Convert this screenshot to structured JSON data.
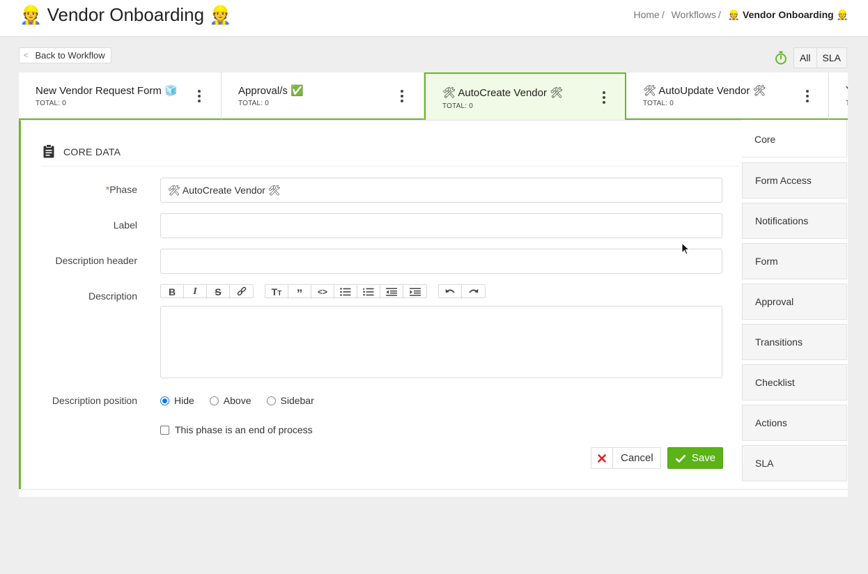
{
  "header": {
    "title": "👷 Vendor Onboarding 👷",
    "breadcrumb": [
      {
        "label": "Home"
      },
      {
        "label": "Workflows"
      }
    ],
    "breadcrumb_sep": "/",
    "breadcrumb_current": "👷 Vendor Onboarding 👷"
  },
  "toolbar": {
    "back_label": "Back to Workflow",
    "back_icon": "chevron-left-icon",
    "timer_icon": "stopwatch-icon",
    "segments": [
      "All",
      "SLA"
    ]
  },
  "phases": [
    {
      "title": "New Vendor Request Form 🧊",
      "total": "TOTAL: 0"
    },
    {
      "title": "Approval/s ✅",
      "total": "TOTAL: 0"
    },
    {
      "title": "🛠 AutoCreate Vendor 🛠",
      "total": "TOTAL: 0"
    },
    {
      "title": "🛠 AutoUpdate Vendor 🛠",
      "total": "TOTAL: 0"
    },
    {
      "title": "Y",
      "total": "T"
    }
  ],
  "active_phase": 2,
  "section": {
    "icon": "clipboard-icon",
    "title": "CORE DATA"
  },
  "form": {
    "required_mark": "*",
    "phase_label": "Phase",
    "phase_value": "🛠 AutoCreate Vendor 🛠",
    "label_label": "Label",
    "label_value": "",
    "desc_header_label": "Description header",
    "desc_header_value": "",
    "description_label": "Description",
    "editor_tools": [
      "bold",
      "italic",
      "strikethrough",
      "link",
      "heading",
      "quote",
      "code",
      "bullet-list",
      "numbered-list",
      "outdent",
      "indent",
      "undo",
      "redo"
    ],
    "desc_position_label": "Description position",
    "desc_position_options": [
      "Hide",
      "Above",
      "Sidebar"
    ],
    "desc_position_selected": "Hide",
    "end_process_label": "This phase is an end of process",
    "end_process_checked": false,
    "cancel_label": "Cancel",
    "save_label": "Save"
  },
  "side_menu": [
    "Core",
    "Form Access",
    "Notifications",
    "Form",
    "Approval",
    "Transitions",
    "Checklist",
    "Actions",
    "SLA"
  ],
  "side_menu_active": "Core",
  "colors": {
    "accent_green": "#67b929",
    "save_green": "#5cb318",
    "cancel_red": "#d9232a",
    "radio_blue": "#1a73e8"
  }
}
